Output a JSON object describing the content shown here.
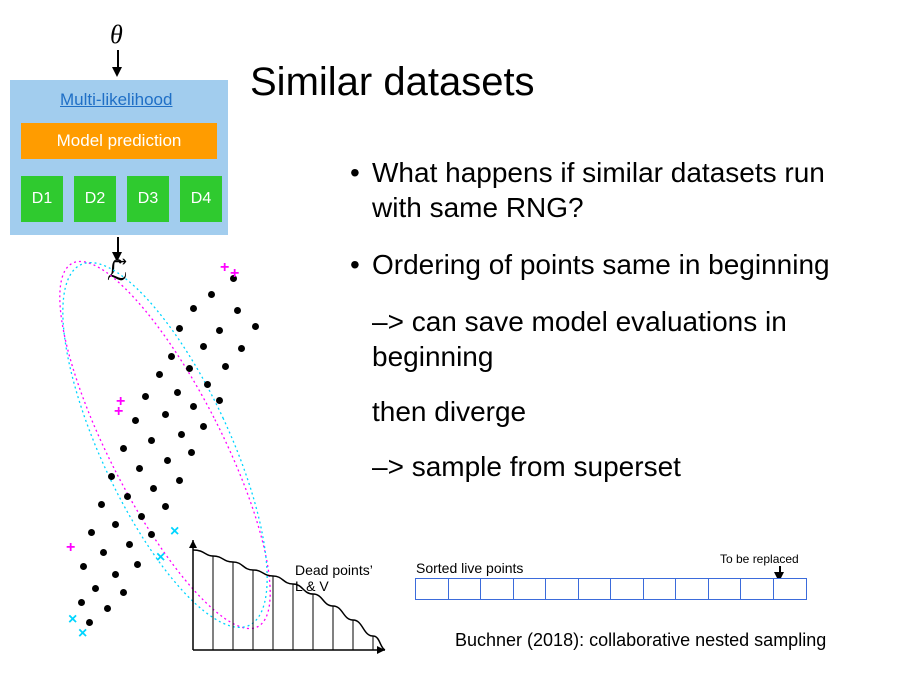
{
  "title": "Similar datasets",
  "bullets": {
    "item1": "What happens if similar datasets run with same RNG?",
    "item2": "Ordering of points same in beginning",
    "follow1": "–> can save model evaluations in beginning",
    "follow2": "then diverge",
    "follow3": "–> sample from superset"
  },
  "diagram": {
    "theta": "θ",
    "multi_likelihood": "Multi-likelihood",
    "model_prediction": "Model prediction",
    "d1": "D1",
    "d2": "D2",
    "d3": "D3",
    "d4": "D4",
    "L_vec": "ℒ⃗"
  },
  "dead_points_label_line1": "Dead points’",
  "dead_points_label_line2": "L & V",
  "sorted_live_label": "Sorted live points",
  "to_be_replaced_label": "To be replaced",
  "citation": "Buchner (2018): collaborative nested sampling",
  "chart_data": {
    "type": "line",
    "title": "Dead points' L & V (schematic decreasing step curve)",
    "x": [
      0,
      1,
      2,
      3,
      4,
      5,
      6,
      7,
      8,
      9,
      10,
      11
    ],
    "values": [
      100,
      95,
      90,
      82,
      78,
      70,
      62,
      52,
      40,
      28,
      14,
      0
    ],
    "xlabel": "",
    "ylabel": "",
    "vertical_bars_at": [
      1,
      2,
      3,
      4,
      5,
      6,
      7,
      8,
      9,
      10,
      11
    ],
    "ylim": [
      0,
      100
    ]
  }
}
